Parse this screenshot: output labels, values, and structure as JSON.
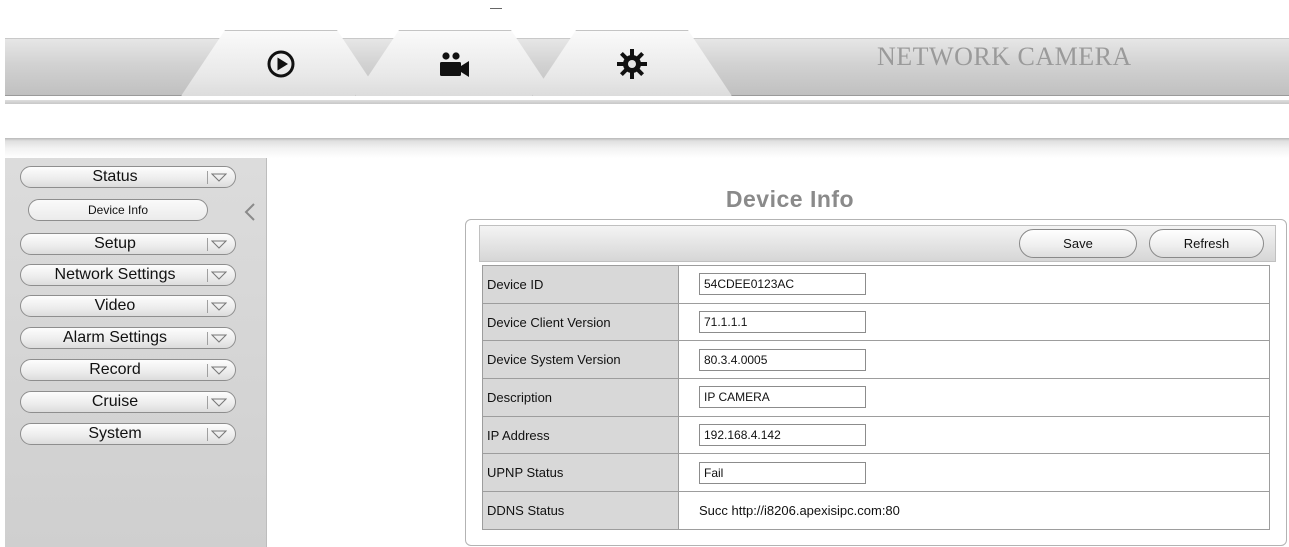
{
  "header": {
    "brand": "NETWORK CAMERA",
    "tabs": [
      {
        "icon": "play-icon"
      },
      {
        "icon": "video-camera-icon"
      },
      {
        "icon": "gear-icon"
      }
    ]
  },
  "sidebar": {
    "items": [
      {
        "label": "Status"
      },
      {
        "label": "Setup"
      },
      {
        "label": "Network Settings"
      },
      {
        "label": "Video"
      },
      {
        "label": "Alarm Settings"
      },
      {
        "label": "Record"
      },
      {
        "label": "Cruise"
      },
      {
        "label": "System"
      }
    ],
    "active_subitem": "Device Info"
  },
  "main": {
    "title": "Device Info",
    "toolbar": {
      "save_label": "Save",
      "refresh_label": "Refresh"
    },
    "rows": [
      {
        "label": "Device ID",
        "value": "54CDEE0123AC",
        "boxed": true
      },
      {
        "label": "Device Client Version",
        "value": "71.1.1.1",
        "boxed": true
      },
      {
        "label": "Device System Version",
        "value": "80.3.4.0005",
        "boxed": true
      },
      {
        "label": "Description",
        "value": "IP CAMERA",
        "boxed": true
      },
      {
        "label": "IP Address",
        "value": "192.168.4.142",
        "boxed": true
      },
      {
        "label": "UPNP Status",
        "value": "Fail",
        "boxed": true
      },
      {
        "label": "DDNS Status",
        "value": "Succ http://i8206.apexisipc.com:80",
        "boxed": false
      }
    ]
  },
  "colors": {
    "title_gray": "#8a8a8a",
    "label_cell_bg": "#d8d8d8",
    "sidebar_bg": "#d4d4d4"
  }
}
